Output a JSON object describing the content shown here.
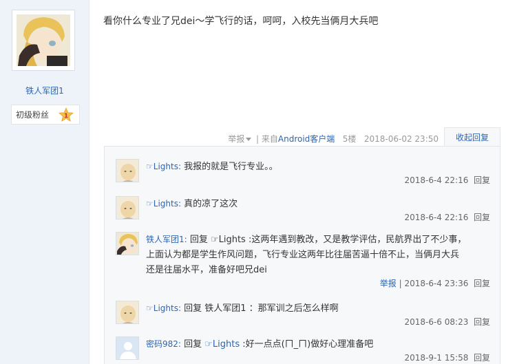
{
  "author": {
    "name": "铁人军团1",
    "fan_level": "初级粉丝",
    "level_num": "1"
  },
  "post": {
    "content": "看你什么专业了兄dei～学飞行的话，呵呵，入校先当俩月大兵吧",
    "report_label": "举报",
    "source_prefix": "| 来自",
    "source_client": "Android客户端",
    "floor": "5楼",
    "timestamp": "2018-06-02 23:50",
    "collapse_label": "收起回复"
  },
  "comments": [
    {
      "user": "☞Lights:",
      "content": " 我报的就是飞行专业。。",
      "time": "2018-6-4 22:16",
      "reply_label": "回复"
    },
    {
      "user": "☞Lights:",
      "content": " 真的凉了这次",
      "time": "2018-6-4 22:16",
      "reply_label": "回复"
    },
    {
      "user": "铁人军团1:",
      "content_line1": " 回复 ☞Lights :这两年遇到教改，又是教学评估，民航界出了不少事，",
      "content_line2": "上面认为都是学生作风问题，飞行专业这两年比往届苦逼十倍不止，当俩月大兵",
      "content_line3": "还是往届水平，准备好吧兄dei",
      "report_label": "举报",
      "time": "2018-6-4 23:36",
      "reply_label": "回复"
    },
    {
      "user": "☞Lights:",
      "content": " 回复 铁人军团1 ：那军训之后怎么样啊",
      "time": "2018-6-6 08:23",
      "reply_label": "回复"
    },
    {
      "user": "密码982:",
      "content_pre": " 回复 ",
      "content_mention": "☞Lights",
      "content_post": " :好一点点(ㄇ_ㄇ)做好心理准备吧",
      "time": "2018-9-1 15:58",
      "reply_label": "回复"
    }
  ]
}
